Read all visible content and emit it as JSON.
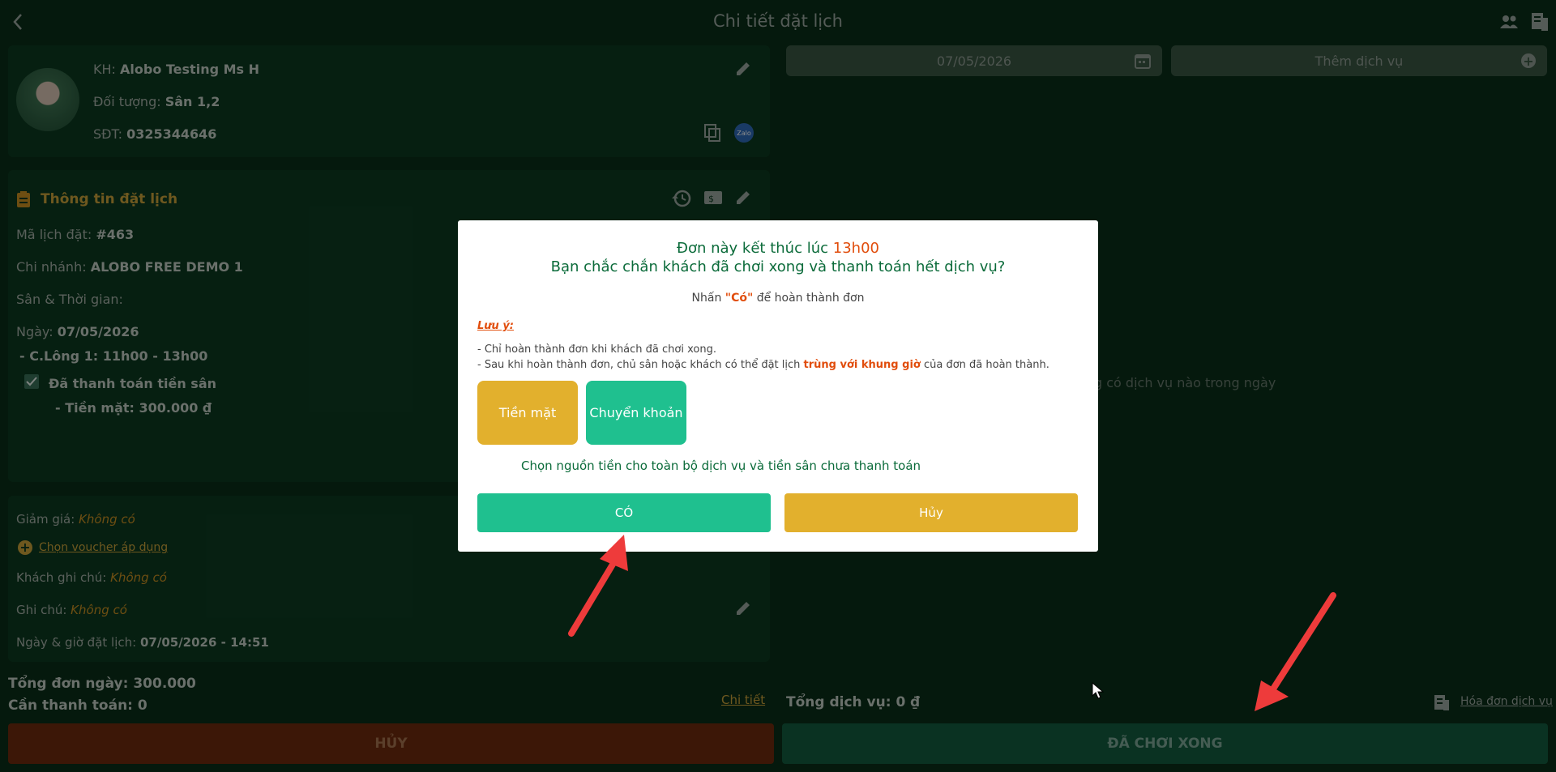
{
  "header": {
    "title": "Chi tiết đặt lịch"
  },
  "customer": {
    "name_label": "KH:",
    "name": "Alobo Testing Ms H",
    "object_label": "Đối tượng:",
    "object": "Sân 1,2",
    "phone_label": "SĐT:",
    "phone": "0325344646",
    "zalo_label": "Zalo"
  },
  "booking": {
    "section_title": "Thông tin đặt lịch",
    "code_label": "Mã lịch đặt:",
    "code": "#463",
    "branch_label": "Chi nhánh:",
    "branch": "ALOBO FREE DEMO 1",
    "court_time_label": "Sân & Thời gian:",
    "date_label": "Ngày:",
    "date": "07/05/2026",
    "slot": "- C.Lông 1: 11h00 - 13h00",
    "paid_label": "Đã thanh toán tiền sân",
    "paid_detail": "- Tiền mặt: 300.000 ₫"
  },
  "extras": {
    "discount_label": "Giảm giá:",
    "discount": "Không có",
    "voucher_link": "Chọn voucher áp dụng",
    "customer_note_label": "Khách ghi chú:",
    "customer_note": "Không có",
    "note_label": "Ghi chú:",
    "note": "Không có",
    "booked_at_label": "Ngày & giờ đặt lịch:",
    "booked_at": "07/05/2026 - 14:51"
  },
  "totals": {
    "day_total": "Tổng đơn ngày: 300.000",
    "to_pay": "Cần thanh toán: 0",
    "detail_link": "Chi tiết",
    "service_total": "Tổng dịch vụ: 0 ₫",
    "invoice_link": "Hóa đơn dịch vụ"
  },
  "services": {
    "date_value": "07/05/2026",
    "add_service_label": "Thêm dịch vụ",
    "empty_text": "g có dịch vụ nào trong ngày"
  },
  "actions": {
    "cancel": "HỦY",
    "finished": "ĐÃ CHƠI XONG"
  },
  "modal": {
    "title_prefix": "Đơn này kết thúc lúc",
    "end_time": "13h00",
    "question": "Bạn chắc chắn khách đã chơi xong và thanh toán hết dịch vụ?",
    "hint_prefix": "Nhấn",
    "hint_keyword": "\"Có\"",
    "hint_suffix": "để hoàn thành đơn",
    "note_title": "Lưu ý:",
    "note_line1": "- Chỉ hoàn thành đơn khi khách đã chơi xong.",
    "note_line2_prefix": "- Sau khi hoàn thành đơn, chủ sân hoặc khách có thể đặt lịch",
    "note_line2_highlight": "trùng với khung giờ",
    "note_line2_suffix": "của đơn đã hoàn thành.",
    "cash_label": "Tiền mặt",
    "transfer_label": "Chuyển khoản",
    "source_prompt": "Chọn nguồn tiền cho toàn bộ dịch vụ và tiền sân chưa thanh toán",
    "confirm_label": "CÓ",
    "cancel_label": "Hủy"
  },
  "colors": {
    "background": "#0a2e18",
    "panel": "#0c3a20",
    "accent_green": "#1fc08f",
    "accent_yellow": "#e2b02d",
    "danger": "#6e2a0d",
    "highlight_orange": "#e14d0c",
    "arrow_red": "#ee3b3b"
  }
}
